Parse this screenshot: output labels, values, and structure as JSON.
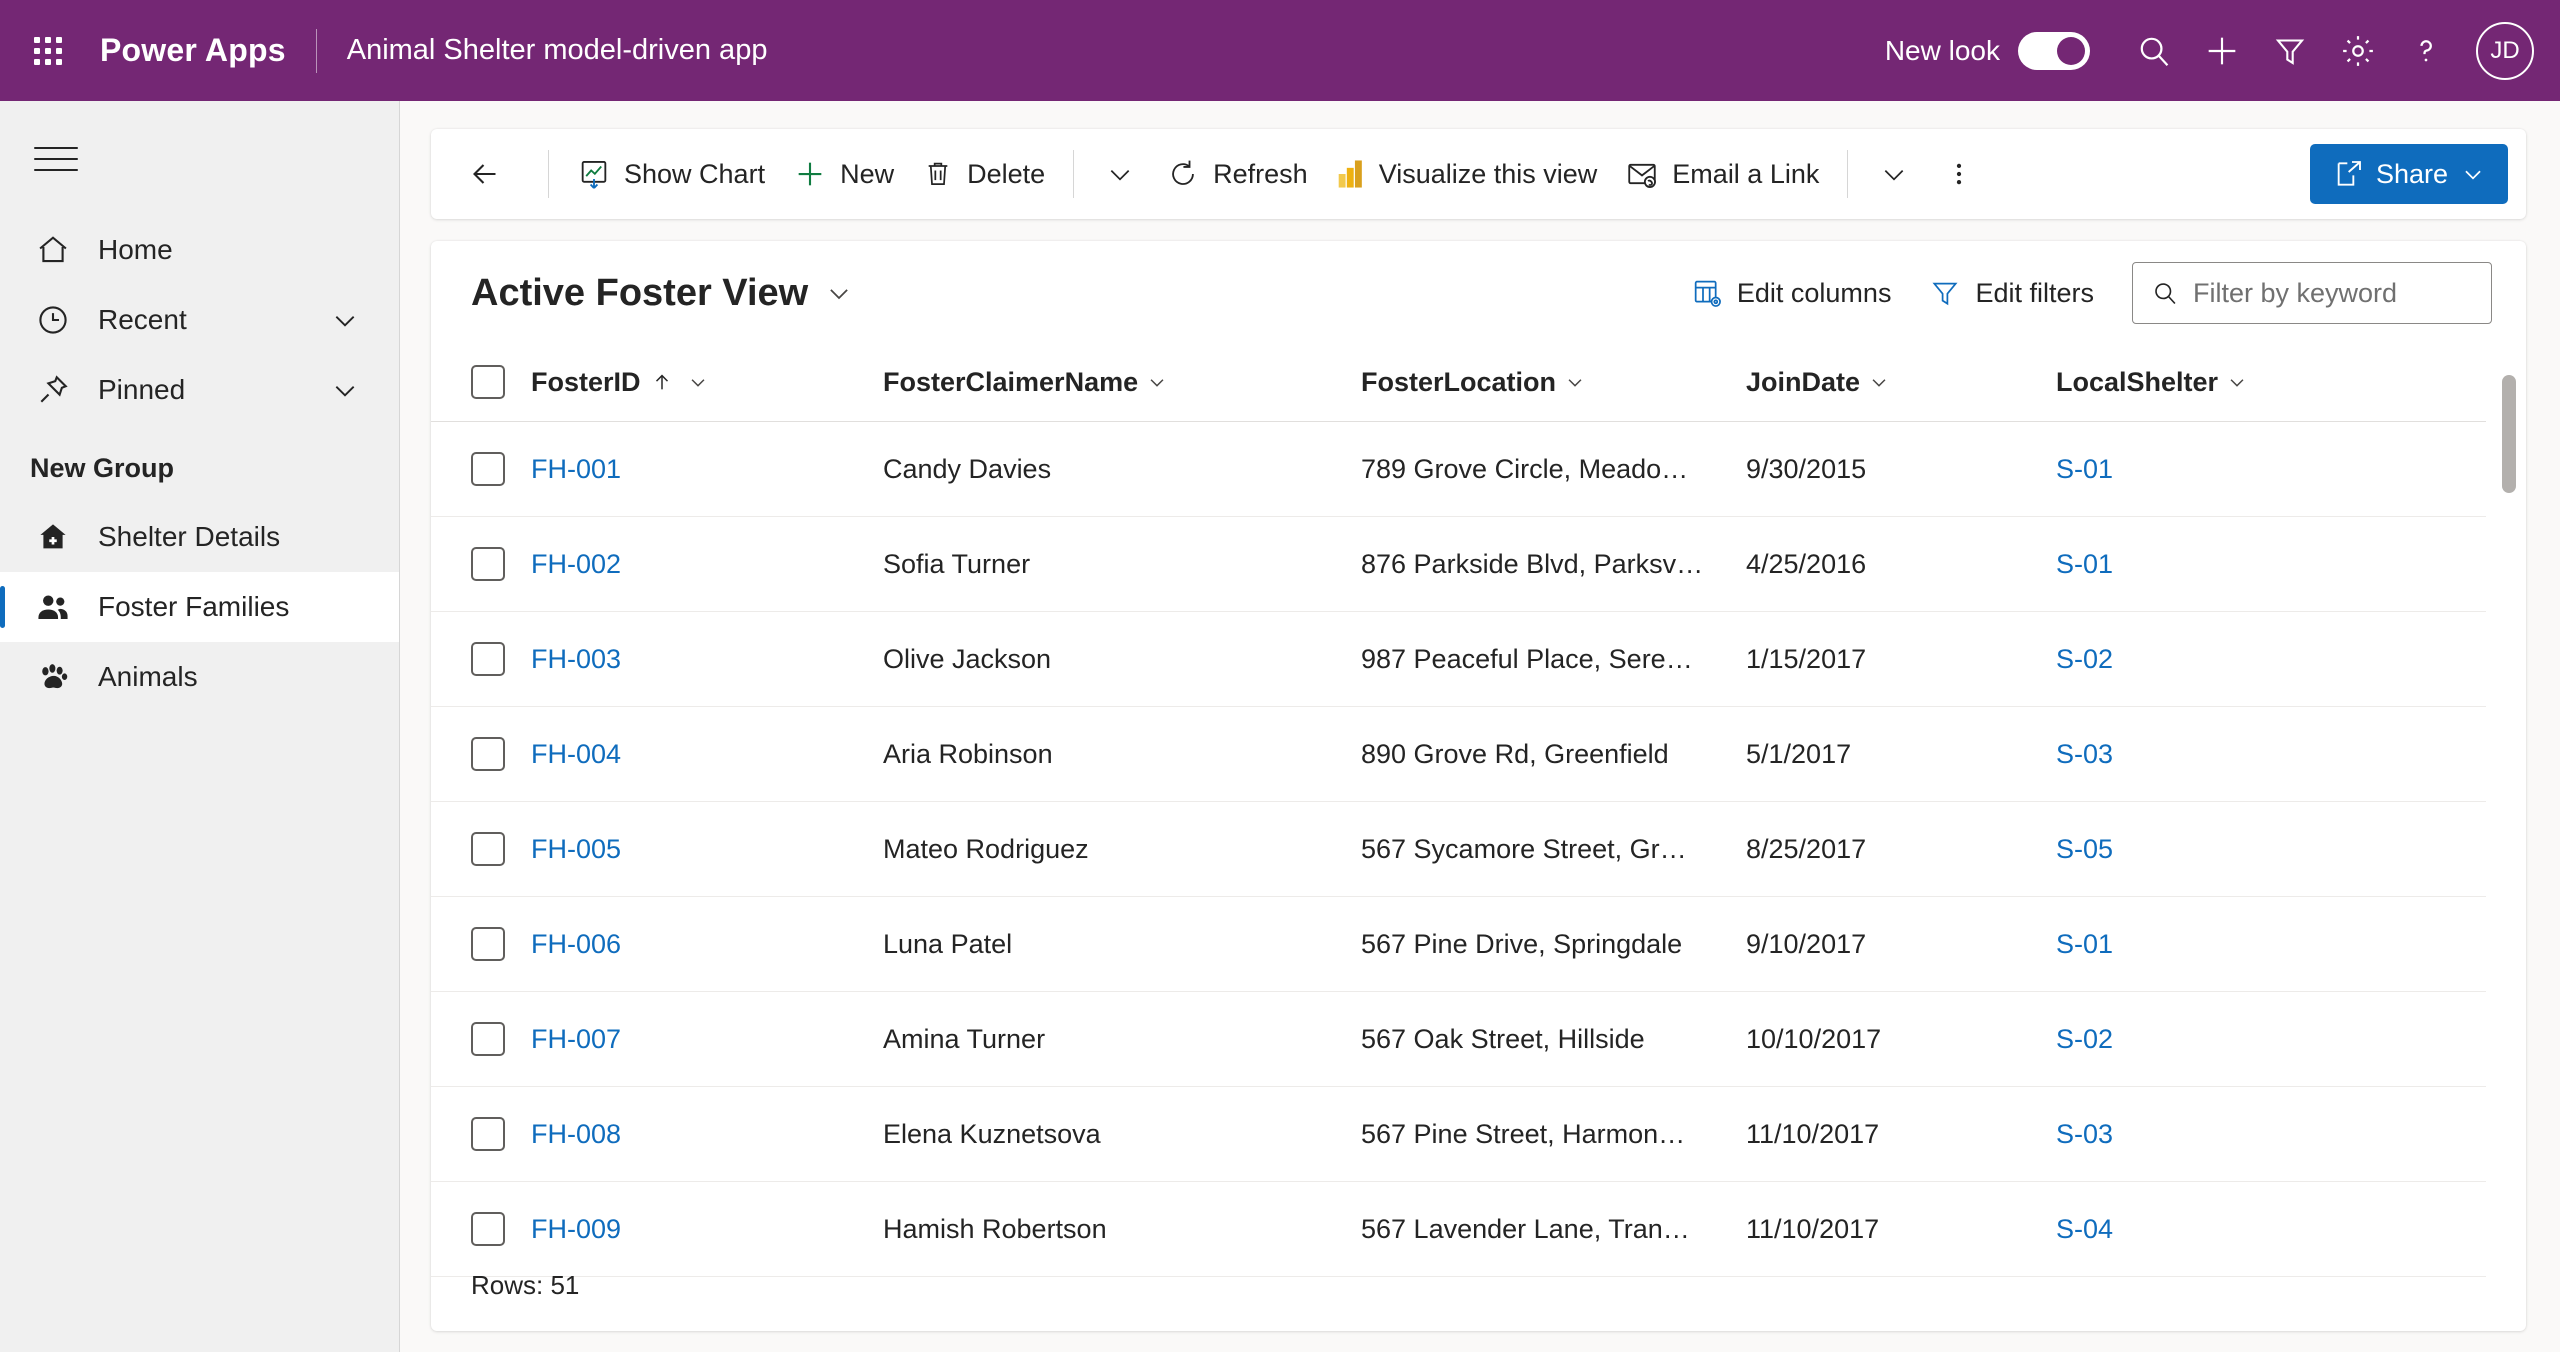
{
  "header": {
    "brand": "Power Apps",
    "app_name": "Animal Shelter model-driven app",
    "new_look_label": "New look",
    "new_look_on": true,
    "avatar_initials": "JD",
    "background_color": "#742774",
    "icons": [
      "waffle-icon",
      "search-icon",
      "plus-icon",
      "filter-icon",
      "gear-icon",
      "help-icon"
    ]
  },
  "sidebar": {
    "items": [
      {
        "label": "Home",
        "icon": "home-icon",
        "expandable": false,
        "selected": false
      },
      {
        "label": "Recent",
        "icon": "clock-icon",
        "expandable": true,
        "selected": false
      },
      {
        "label": "Pinned",
        "icon": "pin-icon",
        "expandable": true,
        "selected": false
      }
    ],
    "group_title": "New Group",
    "group_items": [
      {
        "label": "Shelter Details",
        "icon": "shelter-home-icon",
        "selected": false
      },
      {
        "label": "Foster Families",
        "icon": "people-icon",
        "selected": true
      },
      {
        "label": "Animals",
        "icon": "paw-icon",
        "selected": false
      }
    ]
  },
  "command_bar": {
    "back_label": "Back",
    "buttons": [
      {
        "label": "Show Chart",
        "icon": "show-chart-icon"
      },
      {
        "label": "New",
        "icon": "plus-icon"
      },
      {
        "label": "Delete",
        "icon": "trash-icon"
      }
    ],
    "overflow_chevron_1": "chevron-down-icon",
    "refresh": {
      "label": "Refresh",
      "icon": "refresh-icon"
    },
    "visualize": {
      "label": "Visualize this view",
      "icon": "powerbi-icon"
    },
    "email_link": {
      "label": "Email a Link",
      "icon": "email-link-icon"
    },
    "overflow_chevron_2": "chevron-down-icon",
    "more_commands": "more-vertical-icon",
    "share": {
      "label": "Share",
      "icon": "share-icon",
      "color": "#0f6cbd"
    }
  },
  "view": {
    "title": "Active Foster View",
    "edit_columns_label": "Edit columns",
    "edit_filters_label": "Edit filters",
    "search_placeholder": "Filter by keyword",
    "search_value": ""
  },
  "grid": {
    "columns": [
      {
        "key": "fosterid",
        "label": "FosterID",
        "sorted": "asc"
      },
      {
        "key": "claimer",
        "label": "FosterClaimerName",
        "sorted": null
      },
      {
        "key": "location",
        "label": "FosterLocation",
        "sorted": null
      },
      {
        "key": "joindate",
        "label": "JoinDate",
        "sorted": null
      },
      {
        "key": "shelter",
        "label": "LocalShelter",
        "sorted": null
      }
    ],
    "rows": [
      {
        "fosterid": "FH-001",
        "claimer": "Candy Davies",
        "location": "789 Grove Circle, Meado…",
        "joindate": "9/30/2015",
        "shelter": "S-01"
      },
      {
        "fosterid": "FH-002",
        "claimer": "Sofia Turner",
        "location": "876 Parkside Blvd, Parksv…",
        "joindate": "4/25/2016",
        "shelter": "S-01"
      },
      {
        "fosterid": "FH-003",
        "claimer": "Olive Jackson",
        "location": "987 Peaceful Place, Sere…",
        "joindate": "1/15/2017",
        "shelter": "S-02"
      },
      {
        "fosterid": "FH-004",
        "claimer": "Aria Robinson",
        "location": "890 Grove Rd, Greenfield",
        "joindate": "5/1/2017",
        "shelter": "S-03"
      },
      {
        "fosterid": "FH-005",
        "claimer": "Mateo Rodriguez",
        "location": "567 Sycamore Street, Gr…",
        "joindate": "8/25/2017",
        "shelter": "S-05"
      },
      {
        "fosterid": "FH-006",
        "claimer": "Luna Patel",
        "location": "567 Pine Drive, Springdale",
        "joindate": "9/10/2017",
        "shelter": "S-01"
      },
      {
        "fosterid": "FH-007",
        "claimer": "Amina Turner",
        "location": "567 Oak Street, Hillside",
        "joindate": "10/10/2017",
        "shelter": "S-02"
      },
      {
        "fosterid": "FH-008",
        "claimer": "Elena Kuznetsova",
        "location": "567 Pine Street, Harmon…",
        "joindate": "11/10/2017",
        "shelter": "S-03"
      },
      {
        "fosterid": "FH-009",
        "claimer": "Hamish Robertson",
        "location": "567 Lavender Lane, Tran…",
        "joindate": "11/10/2017",
        "shelter": "S-04"
      }
    ],
    "rows_footer": "Rows: 51",
    "link_color": "#0f6cbd"
  }
}
